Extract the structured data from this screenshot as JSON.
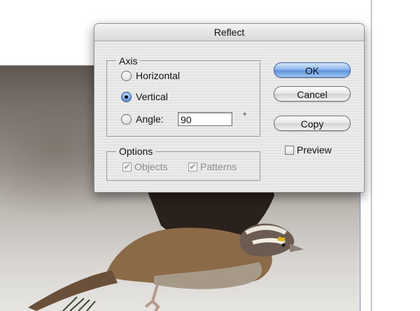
{
  "dialog": {
    "title": "Reflect",
    "axis": {
      "legend": "Axis",
      "options": [
        {
          "label": "Horizontal",
          "selected": false
        },
        {
          "label": "Vertical",
          "selected": true
        },
        {
          "label": "Angle:",
          "selected": false
        }
      ],
      "angle_value": "90",
      "degree_symbol": "°"
    },
    "options_group": {
      "legend": "Options",
      "objects_label": "Objects",
      "objects_checked": true,
      "patterns_label": "Patterns",
      "patterns_checked": true,
      "enabled": false
    },
    "buttons": {
      "ok": "OK",
      "cancel": "Cancel",
      "copy": "Copy"
    },
    "preview": {
      "label": "Preview",
      "checked": false
    }
  },
  "colors": {
    "primary_button": "#6b9be0",
    "dialog_background": "#e9e9e9"
  }
}
